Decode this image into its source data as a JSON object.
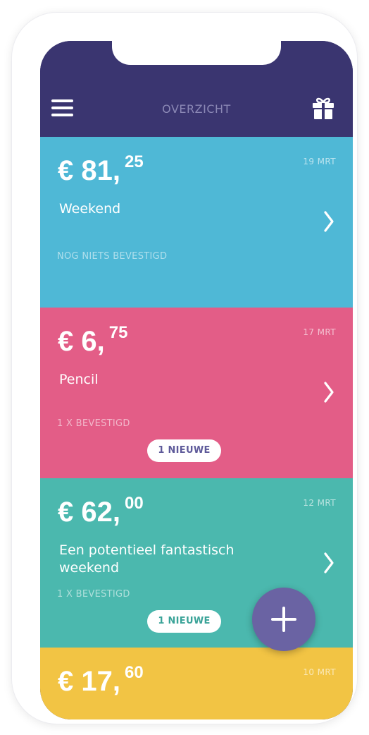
{
  "header": {
    "title": "OVERZICHT",
    "menu_icon": "hamburger-menu-icon",
    "gift_icon": "gift-icon",
    "background": "#3a3570"
  },
  "cards": [
    {
      "currency": "€",
      "amount_whole": "81,",
      "amount_cents": "25",
      "date": "19 MRT",
      "title": "Weekend",
      "status": "NOG NIETS BEVESTIGD",
      "badge": "",
      "color": "#4fb8d6"
    },
    {
      "currency": "€",
      "amount_whole": "6,",
      "amount_cents": "75",
      "date": "17 MRT",
      "title": "Pencil",
      "status": "1 X BEVESTIGD",
      "badge": "1 NIEUWE",
      "color": "#e35d87"
    },
    {
      "currency": "€",
      "amount_whole": "62,",
      "amount_cents": "00",
      "date": "12 MRT",
      "title": "Een potentieel fantastisch weekend",
      "status": "1 X BEVESTIGD",
      "badge": "1 NIEUWE",
      "color": "#4bb8ae"
    },
    {
      "currency": "€",
      "amount_whole": "17,",
      "amount_cents": "60",
      "date": "10 MRT",
      "title": "",
      "status": "",
      "badge": "",
      "color": "#f2c444"
    }
  ],
  "fab": {
    "icon": "plus-icon",
    "color": "#6a63a3"
  }
}
